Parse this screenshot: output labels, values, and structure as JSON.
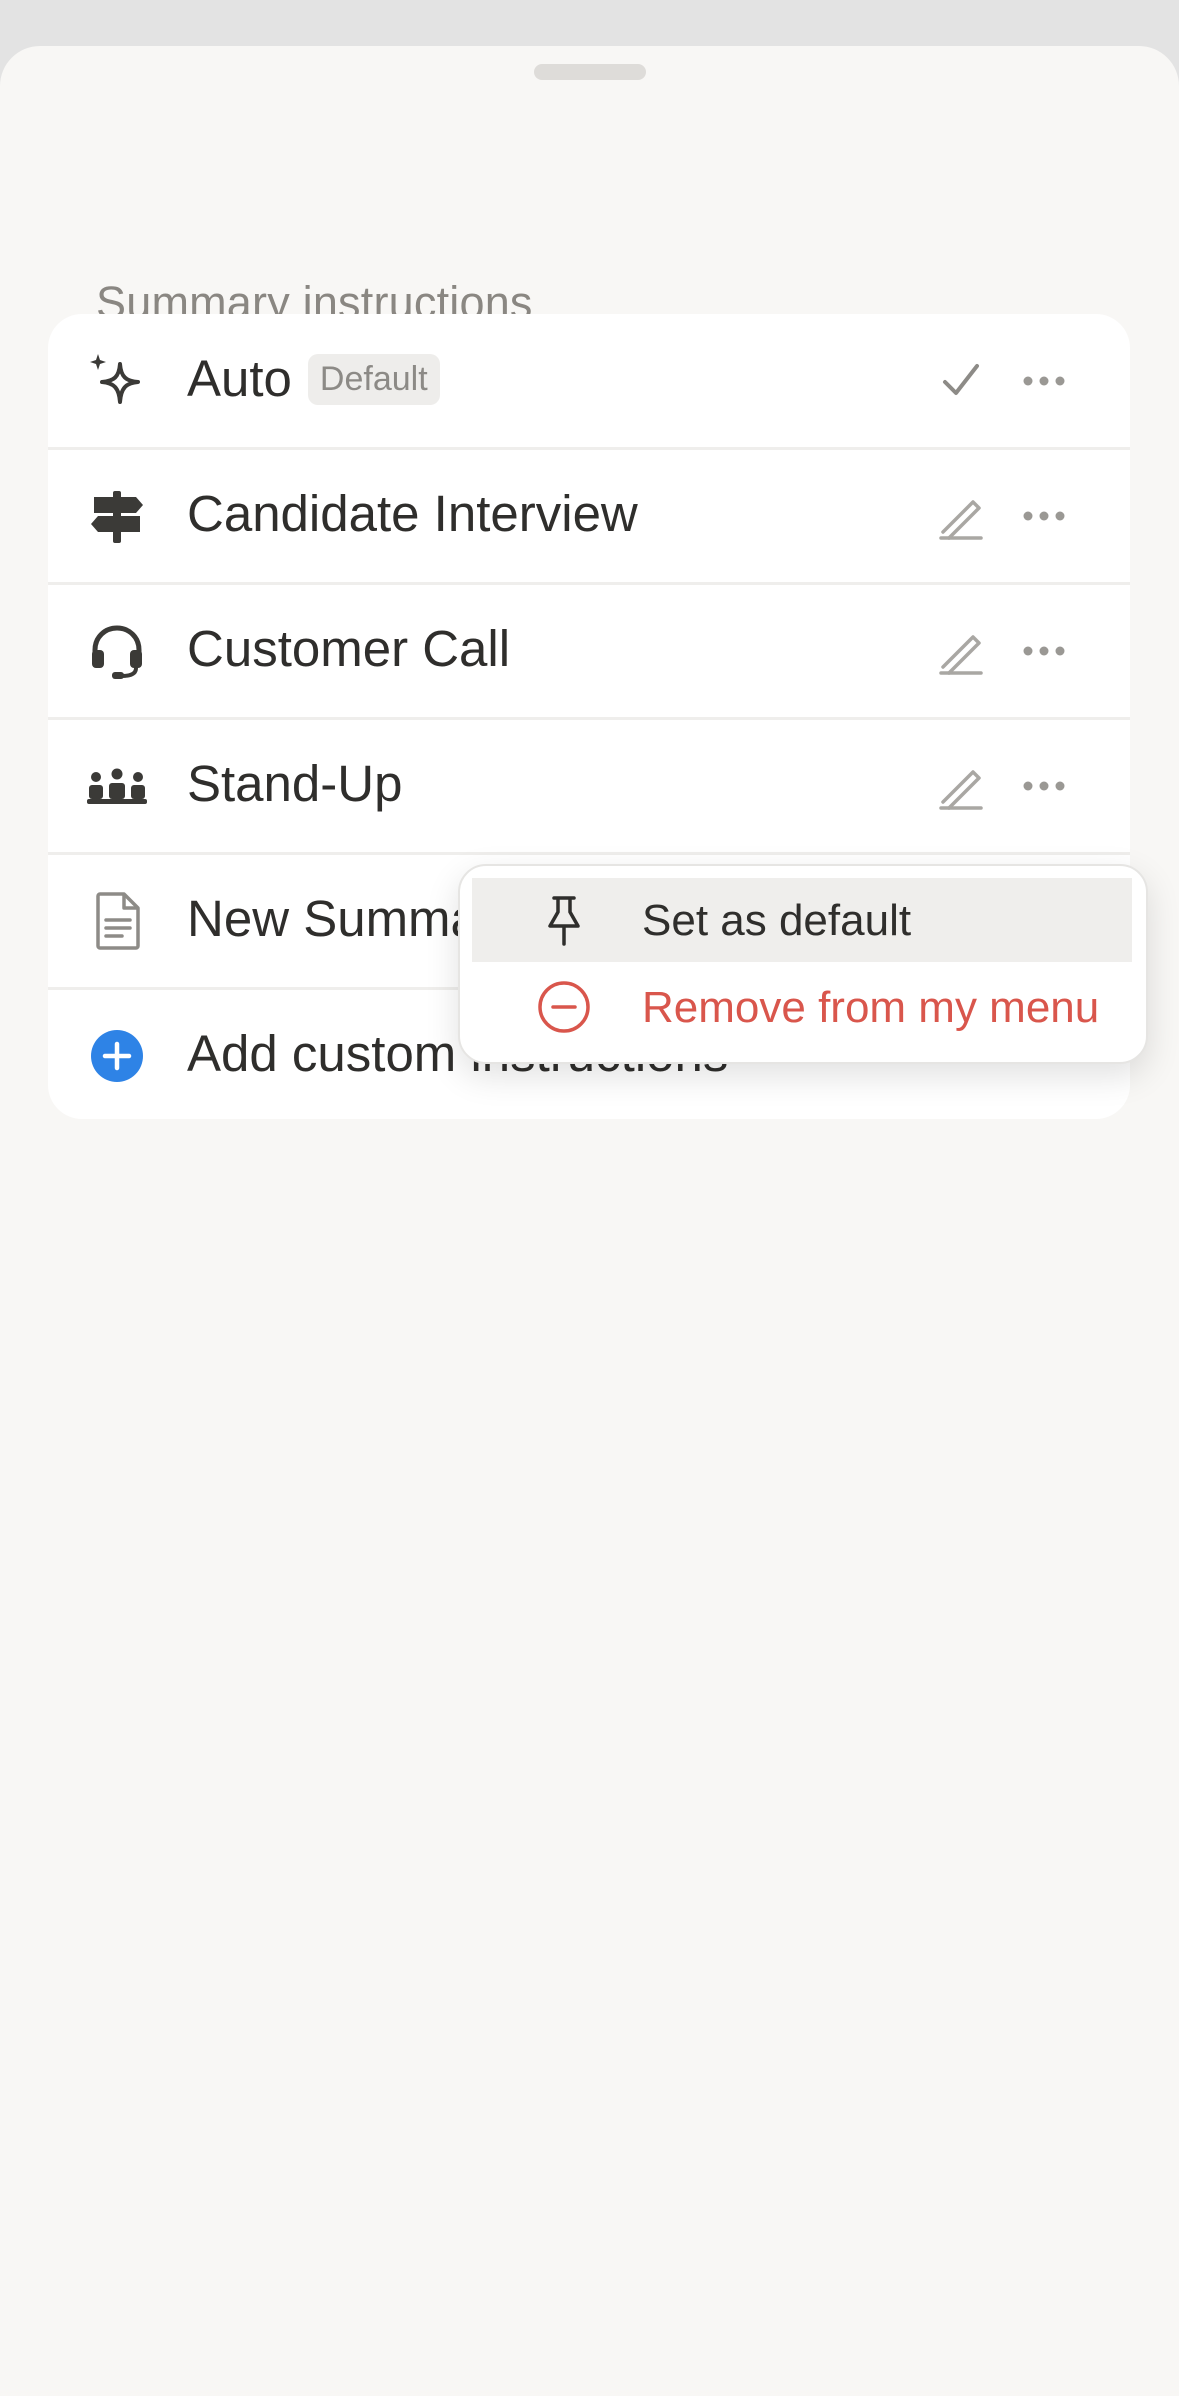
{
  "sheet": {
    "section_title": "Summary instructions"
  },
  "rows": [
    {
      "label": "Auto",
      "badge": "Default",
      "icon": "sparkles-icon",
      "action": "checkmark-icon"
    },
    {
      "label": "Candidate Interview",
      "icon": "signpost-icon",
      "action": "edit-pencil-icon"
    },
    {
      "label": "Customer Call",
      "icon": "headset-icon",
      "action": "edit-pencil-icon"
    },
    {
      "label": "Stand-Up",
      "icon": "people-group-icon",
      "action": "edit-pencil-icon"
    },
    {
      "label": "New Summary",
      "icon": "document-icon",
      "action": "none"
    },
    {
      "label": "Add custom instructions",
      "icon": "plus-circle-icon",
      "action": "none"
    }
  ],
  "context_menu": {
    "items": [
      {
        "label": "Set as default",
        "icon": "pin-icon",
        "color": "#2f2e2c",
        "highlighted": true
      },
      {
        "label": "Remove from my menu",
        "icon": "minus-circle-icon",
        "color": "#d9564c",
        "highlighted": false
      }
    ]
  },
  "colors": {
    "accent_blue": "#2e83e6",
    "destructive_red": "#d9564c",
    "icon_gray": "#4a4946",
    "muted_gray": "#a9a7a3"
  }
}
